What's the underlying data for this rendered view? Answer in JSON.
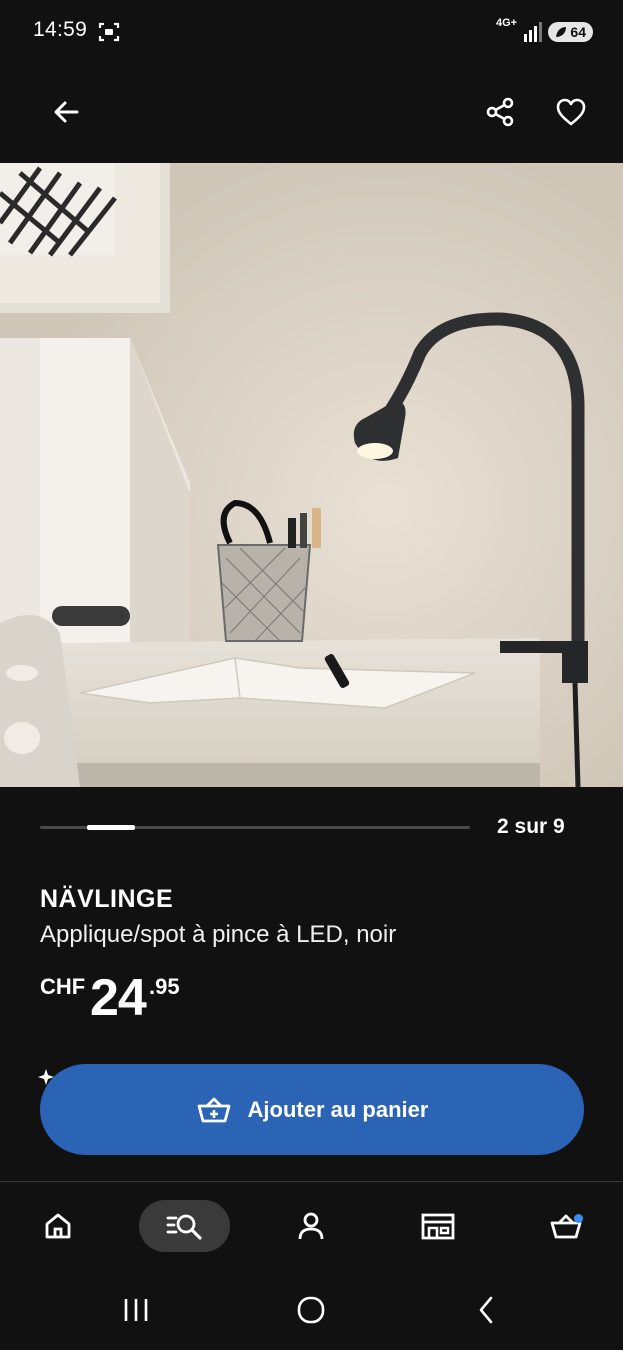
{
  "status_bar": {
    "time": "14:59",
    "network": "4G+",
    "battery": "64",
    "icons": [
      "screenshot-icon",
      "signal-icon",
      "battery-saver-icon"
    ]
  },
  "app_bar": {
    "icons": [
      "back-arrow-icon",
      "share-icon",
      "heart-icon"
    ]
  },
  "carousel": {
    "counter": "2 sur 9",
    "current": 2,
    "total": 9
  },
  "product": {
    "name": "NÄVLINGE",
    "description": "Applique/spot à pince à LED, noir",
    "price": {
      "currency": "CHF",
      "whole": "24",
      "decimals": ".95"
    }
  },
  "cta": {
    "label": "Ajouter au panier",
    "icon": "basket-plus-icon",
    "color": "#2b63b5"
  },
  "bottom_nav": {
    "items": [
      {
        "name": "home",
        "icon": "home-icon",
        "active": false
      },
      {
        "name": "search",
        "icon": "search-list-icon",
        "active": true
      },
      {
        "name": "profile",
        "icon": "person-icon",
        "active": false
      },
      {
        "name": "stores",
        "icon": "store-icon",
        "active": false
      },
      {
        "name": "cart",
        "icon": "basket-icon",
        "active": false,
        "badge": true
      }
    ]
  },
  "colors": {
    "background": "#111111",
    "accent": "#2b63b5",
    "badge": "#3b8bf0"
  }
}
